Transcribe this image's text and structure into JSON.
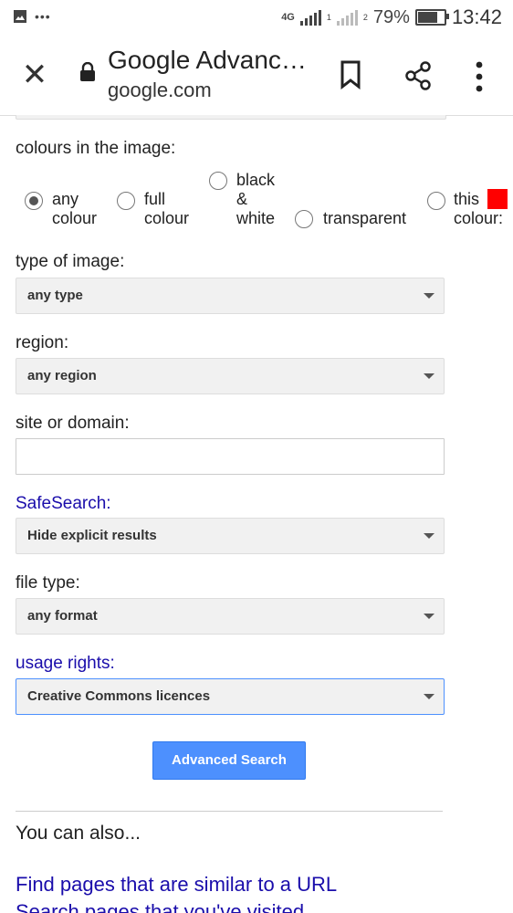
{
  "status_bar": {
    "network": "4G",
    "sim1": "1",
    "sim2": "2",
    "battery": "79%",
    "battery_level": 0.79,
    "time": "13:42"
  },
  "toolbar": {
    "title": "Google Advanc…",
    "url": "google.com",
    "icons": [
      "close-icon",
      "lock-icon",
      "bookmark-icon",
      "share-icon",
      "more-vert-icon"
    ]
  },
  "colours": {
    "label": "colours in the image:",
    "options": [
      {
        "label": "any colour",
        "lines": [
          "any",
          "colour"
        ],
        "checked": true
      },
      {
        "label": "full colour",
        "lines": [
          "full",
          "colour"
        ],
        "checked": false
      },
      {
        "label": "black & white",
        "lines": [
          "black",
          "&",
          "white"
        ],
        "checked": false
      },
      {
        "label": "transparent",
        "lines": [
          "transparent"
        ],
        "checked": false
      },
      {
        "label": "this colour:",
        "lines": [
          "this",
          "colour:"
        ],
        "checked": false
      }
    ],
    "swatch_color": "#ff0000"
  },
  "type_of_image": {
    "label": "type of image:",
    "value": "any type"
  },
  "region": {
    "label": "region:",
    "value": "any region"
  },
  "site": {
    "label": "site or domain:",
    "value": ""
  },
  "safesearch": {
    "label": "SafeSearch:",
    "value": "Hide explicit results"
  },
  "file_type": {
    "label": "file type:",
    "value": "any format"
  },
  "usage_rights": {
    "label": "usage rights:",
    "value": "Creative Commons licences"
  },
  "submit": {
    "label": "Advanced Search"
  },
  "also": {
    "heading": "You can also...",
    "links": [
      "Find pages that are similar to a URL",
      "Search pages that you've visited"
    ]
  },
  "colors": {
    "link": "#1a0dab",
    "button": "#4d90fe"
  }
}
